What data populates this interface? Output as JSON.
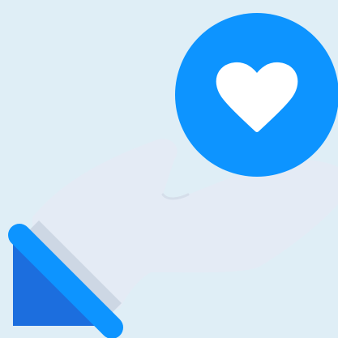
{
  "illustration": {
    "subject": "hand-holding-heart",
    "icons": [
      "hand-icon",
      "heart-icon",
      "cuff-icon"
    ],
    "colors": {
      "background": "#dfeef6",
      "hand": "#e4ebf5",
      "hand_shadow": "#cdd7e4",
      "badge": "#0d94ff",
      "heart": "#ffffff",
      "cuff": "#0d94ff",
      "cuff_dark": "#1c6ede"
    }
  }
}
